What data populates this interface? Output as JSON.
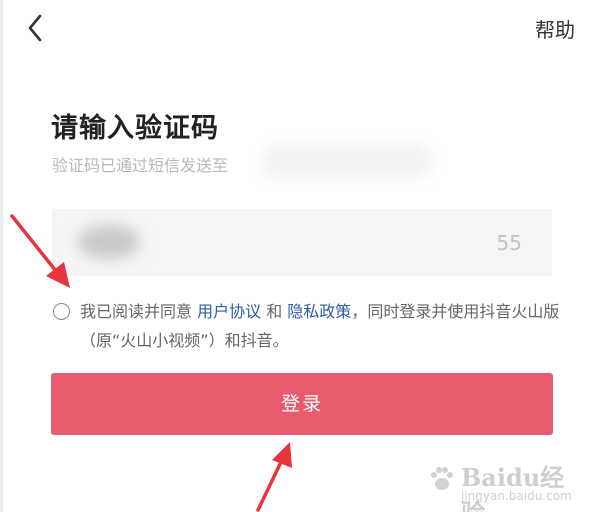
{
  "header": {
    "back_icon": "chevron-left-icon",
    "help_label": "帮助"
  },
  "main": {
    "title": "请输入验证码",
    "subtitle": "验证码已通过短信发送至",
    "countdown": "55"
  },
  "agreement": {
    "text_1": "我已阅读并同意 ",
    "link_terms": "用户协议",
    "text_2": " 和 ",
    "link_privacy": "隐私政策",
    "text_3": "，同时登录并使用抖音火山版（原“火山小视频”）和抖音。"
  },
  "login_button": "登录",
  "watermark": {
    "main": "Baidu经验",
    "sub": "jingyan.baidu.com"
  },
  "colors": {
    "accent": "#e85a6e",
    "link": "#2d5ea8",
    "arrow": "#e8343c"
  }
}
